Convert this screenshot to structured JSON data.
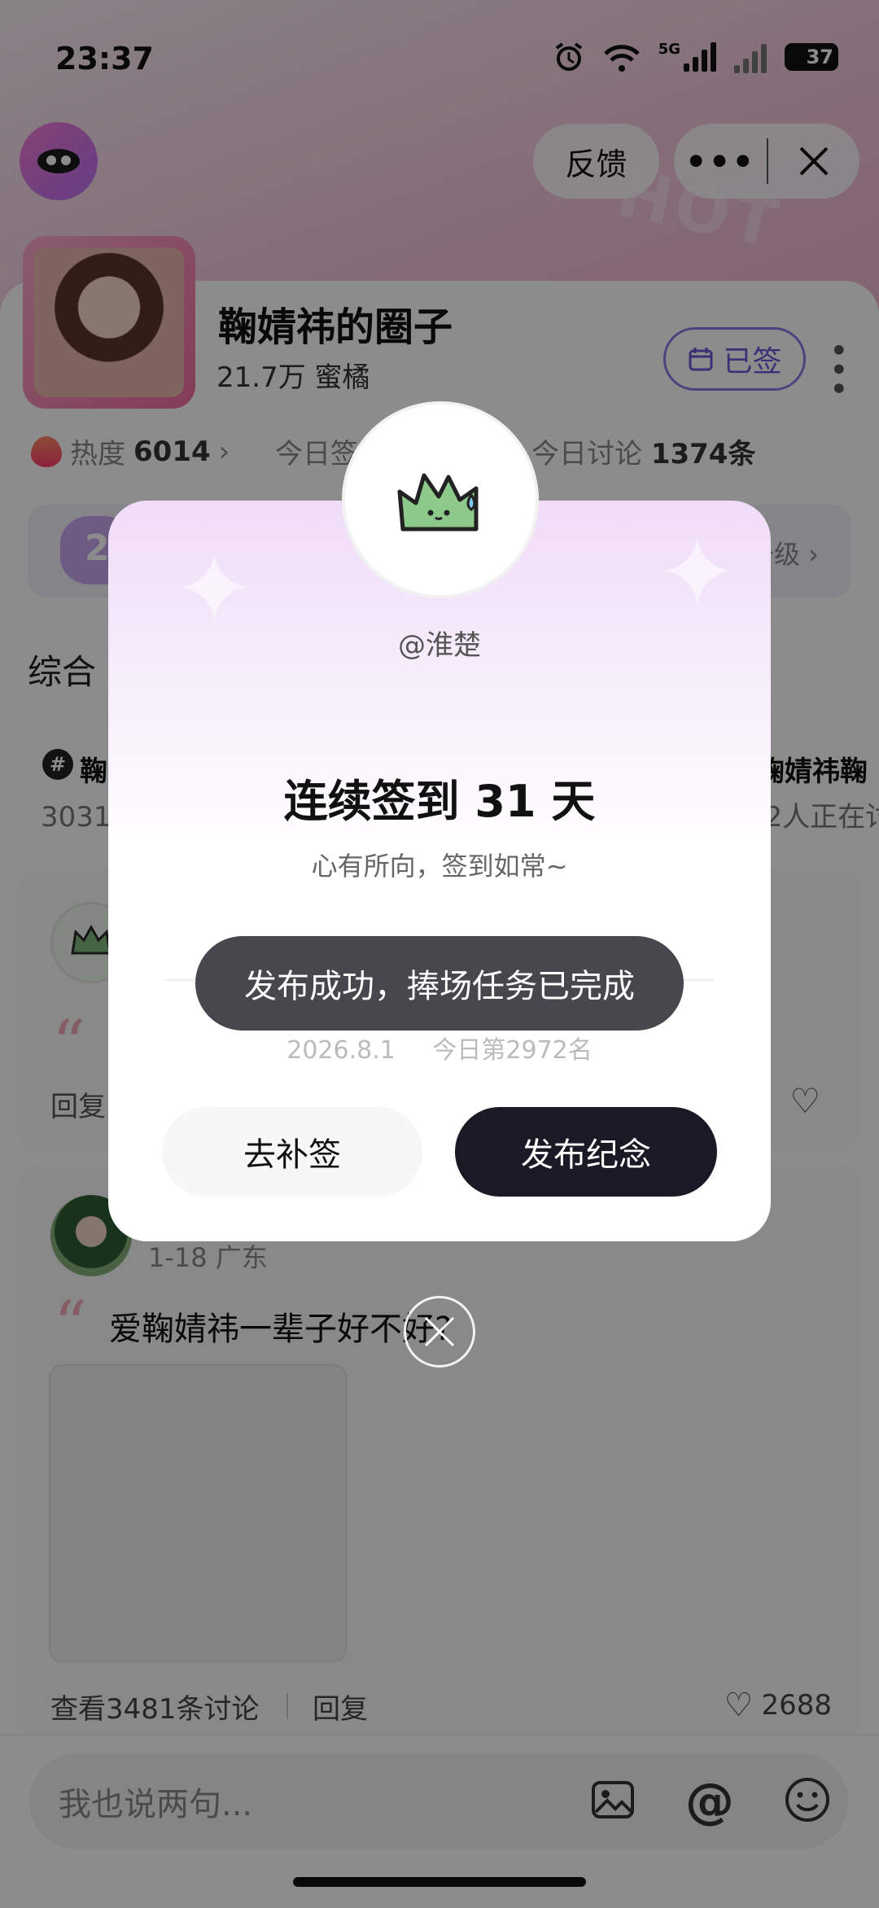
{
  "status_bar": {
    "time": "23:37",
    "network": "5G",
    "battery": "37"
  },
  "top_nav": {
    "feedback_label": "反馈",
    "more_label": "•••"
  },
  "circle": {
    "title": "鞠婧祎的圈子",
    "members": "21.7万 蜜橘",
    "signed_label": "已签",
    "heat_label": "热度",
    "heat_value": "6014",
    "heat_arrow": "›",
    "today_sign_label": "今日签",
    "today_discussion_label": "今日讨论",
    "today_discussion_value": "1374条",
    "hot_badge": "HOT",
    "level_number": "2",
    "level_text": "升级 ›",
    "tab_all": "综合"
  },
  "topics": {
    "left_title": "鞠",
    "left_sub": "3031人",
    "right_title": "鞠婧祎鞠",
    "right_sub": "52人正在讨"
  },
  "posts": {
    "post1": {
      "reply_label": "回复"
    },
    "post2": {
      "meta": "1-18 广东",
      "text": "爱鞠婧祎一辈子好不好?",
      "view_discussion": "查看3481条讨论",
      "reply_label": "回复",
      "likes": "2688"
    }
  },
  "bottom_bar": {
    "placeholder": "我也说两句..."
  },
  "dialog": {
    "username": "@淮楚",
    "headline": "连续签到 31 天",
    "subline": "心有所向，签到如常~",
    "date": "2026.8.1",
    "rank": "今日第2972名",
    "makeup_button": "去补签",
    "publish_button": "发布纪念"
  },
  "toast": {
    "message": "发布成功，捧场任务已完成"
  },
  "colors": {
    "accent_purple": "#6d56d6",
    "primary_button": "#1a1a26",
    "quote_pink": "#f2a9b6"
  }
}
